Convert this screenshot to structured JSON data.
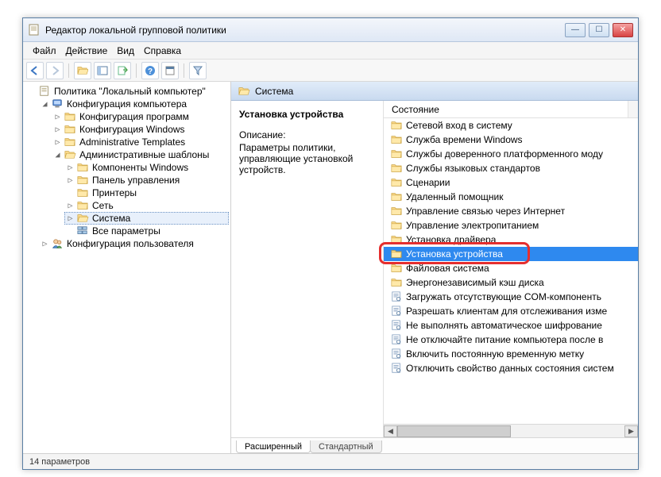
{
  "window": {
    "title": "Редактор локальной групповой политики"
  },
  "menu": {
    "file": "Файл",
    "action": "Действие",
    "view": "Вид",
    "help": "Справка"
  },
  "tree": {
    "root": "Политика \"Локальный компьютер\"",
    "computer_cfg": "Конфигурация компьютера",
    "cfg_programs": "Конфигурация программ",
    "cfg_windows": "Конфигурация Windows",
    "admin_templates": "Administrative Templates",
    "admin_templates_ru": "Административные шаблоны",
    "comp_windows": "Компоненты Windows",
    "control_panel": "Панель управления",
    "printers": "Принтеры",
    "network": "Сеть",
    "system": "Система",
    "all_params": "Все параметры",
    "user_cfg": "Конфигурация пользователя"
  },
  "header": {
    "section": "Система"
  },
  "desc": {
    "title": "Установка устройства",
    "label": "Описание:",
    "text": "Параметры политики, управляющие установкой устройств."
  },
  "column": {
    "state": "Состояние"
  },
  "items": [
    {
      "type": "folder",
      "label": "Сетевой вход в систему"
    },
    {
      "type": "folder",
      "label": "Служба времени Windows"
    },
    {
      "type": "folder",
      "label": "Службы доверенного платформенного моду"
    },
    {
      "type": "folder",
      "label": "Службы языковых стандартов"
    },
    {
      "type": "folder",
      "label": "Сценарии"
    },
    {
      "type": "folder",
      "label": "Удаленный помощник"
    },
    {
      "type": "folder",
      "label": "Управление связью через Интернет"
    },
    {
      "type": "folder",
      "label": "Управление электропитанием"
    },
    {
      "type": "folder",
      "label": "Установка драйвера"
    },
    {
      "type": "folder",
      "label": "Установка устройства",
      "selected": true
    },
    {
      "type": "folder",
      "label": "Файловая система"
    },
    {
      "type": "folder",
      "label": "Энергонезависимый кэш диска"
    },
    {
      "type": "setting",
      "label": "Загружать отсутствующие COM-компоненть"
    },
    {
      "type": "setting",
      "label": "Разрешать клиентам для отслеживания изме"
    },
    {
      "type": "setting",
      "label": "Не выполнять автоматическое шифрование"
    },
    {
      "type": "setting",
      "label": "Не отключайте питание компьютера после в"
    },
    {
      "type": "setting",
      "label": "Включить постоянную временную метку"
    },
    {
      "type": "setting",
      "label": "Отключить свойство данных состояния систем"
    }
  ],
  "tabs": {
    "extended": "Расширенный",
    "standard": "Стандартный"
  },
  "status": {
    "text": "14 параметров"
  }
}
